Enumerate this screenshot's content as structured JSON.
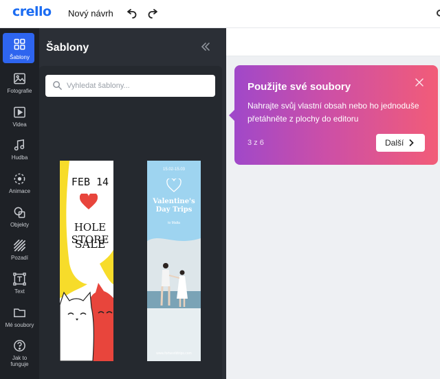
{
  "app": {
    "logo": "crello",
    "new_design": "Nový návrh"
  },
  "sidebar": {
    "items": [
      {
        "label": "Šablony",
        "icon": "grid-icon",
        "active": true
      },
      {
        "label": "Fotografie",
        "icon": "image-icon"
      },
      {
        "label": "Videa",
        "icon": "video-icon"
      },
      {
        "label": "Hudba",
        "icon": "music-icon"
      },
      {
        "label": "Animace",
        "icon": "animation-icon"
      },
      {
        "label": "Objekty",
        "icon": "shapes-icon"
      },
      {
        "label": "Pozadí",
        "icon": "background-icon"
      },
      {
        "label": "Text",
        "icon": "text-icon"
      },
      {
        "label": "Mé soubory",
        "icon": "folder-icon"
      },
      {
        "label": "Jak to funguje",
        "icon": "help-icon"
      }
    ]
  },
  "panel": {
    "title": "Šablony",
    "search_placeholder": "Vyhledat šablony..."
  },
  "templates": {
    "sale": {
      "line1": "FEB 14",
      "line2": "HOLE STORE",
      "line3": "SALE"
    },
    "trips": {
      "date": "15.02-15.03",
      "title_line1": "Valentine's",
      "title_line2": "Day Trips",
      "subtitle": "to Malta",
      "url": "www.fortworldtrips.com"
    }
  },
  "tooltip": {
    "title": "Použijte své soubory",
    "body": "Nahrajte svůj vlastní obsah nebo ho jednoduše přetáhněte z plochy do editoru",
    "step": "3 z 6",
    "next_label": "Další"
  },
  "colors": {
    "brand": "#1b6cf2",
    "active": "#2e65ef",
    "tooltip_start": "#a048c9",
    "tooltip_end": "#f25c78"
  }
}
